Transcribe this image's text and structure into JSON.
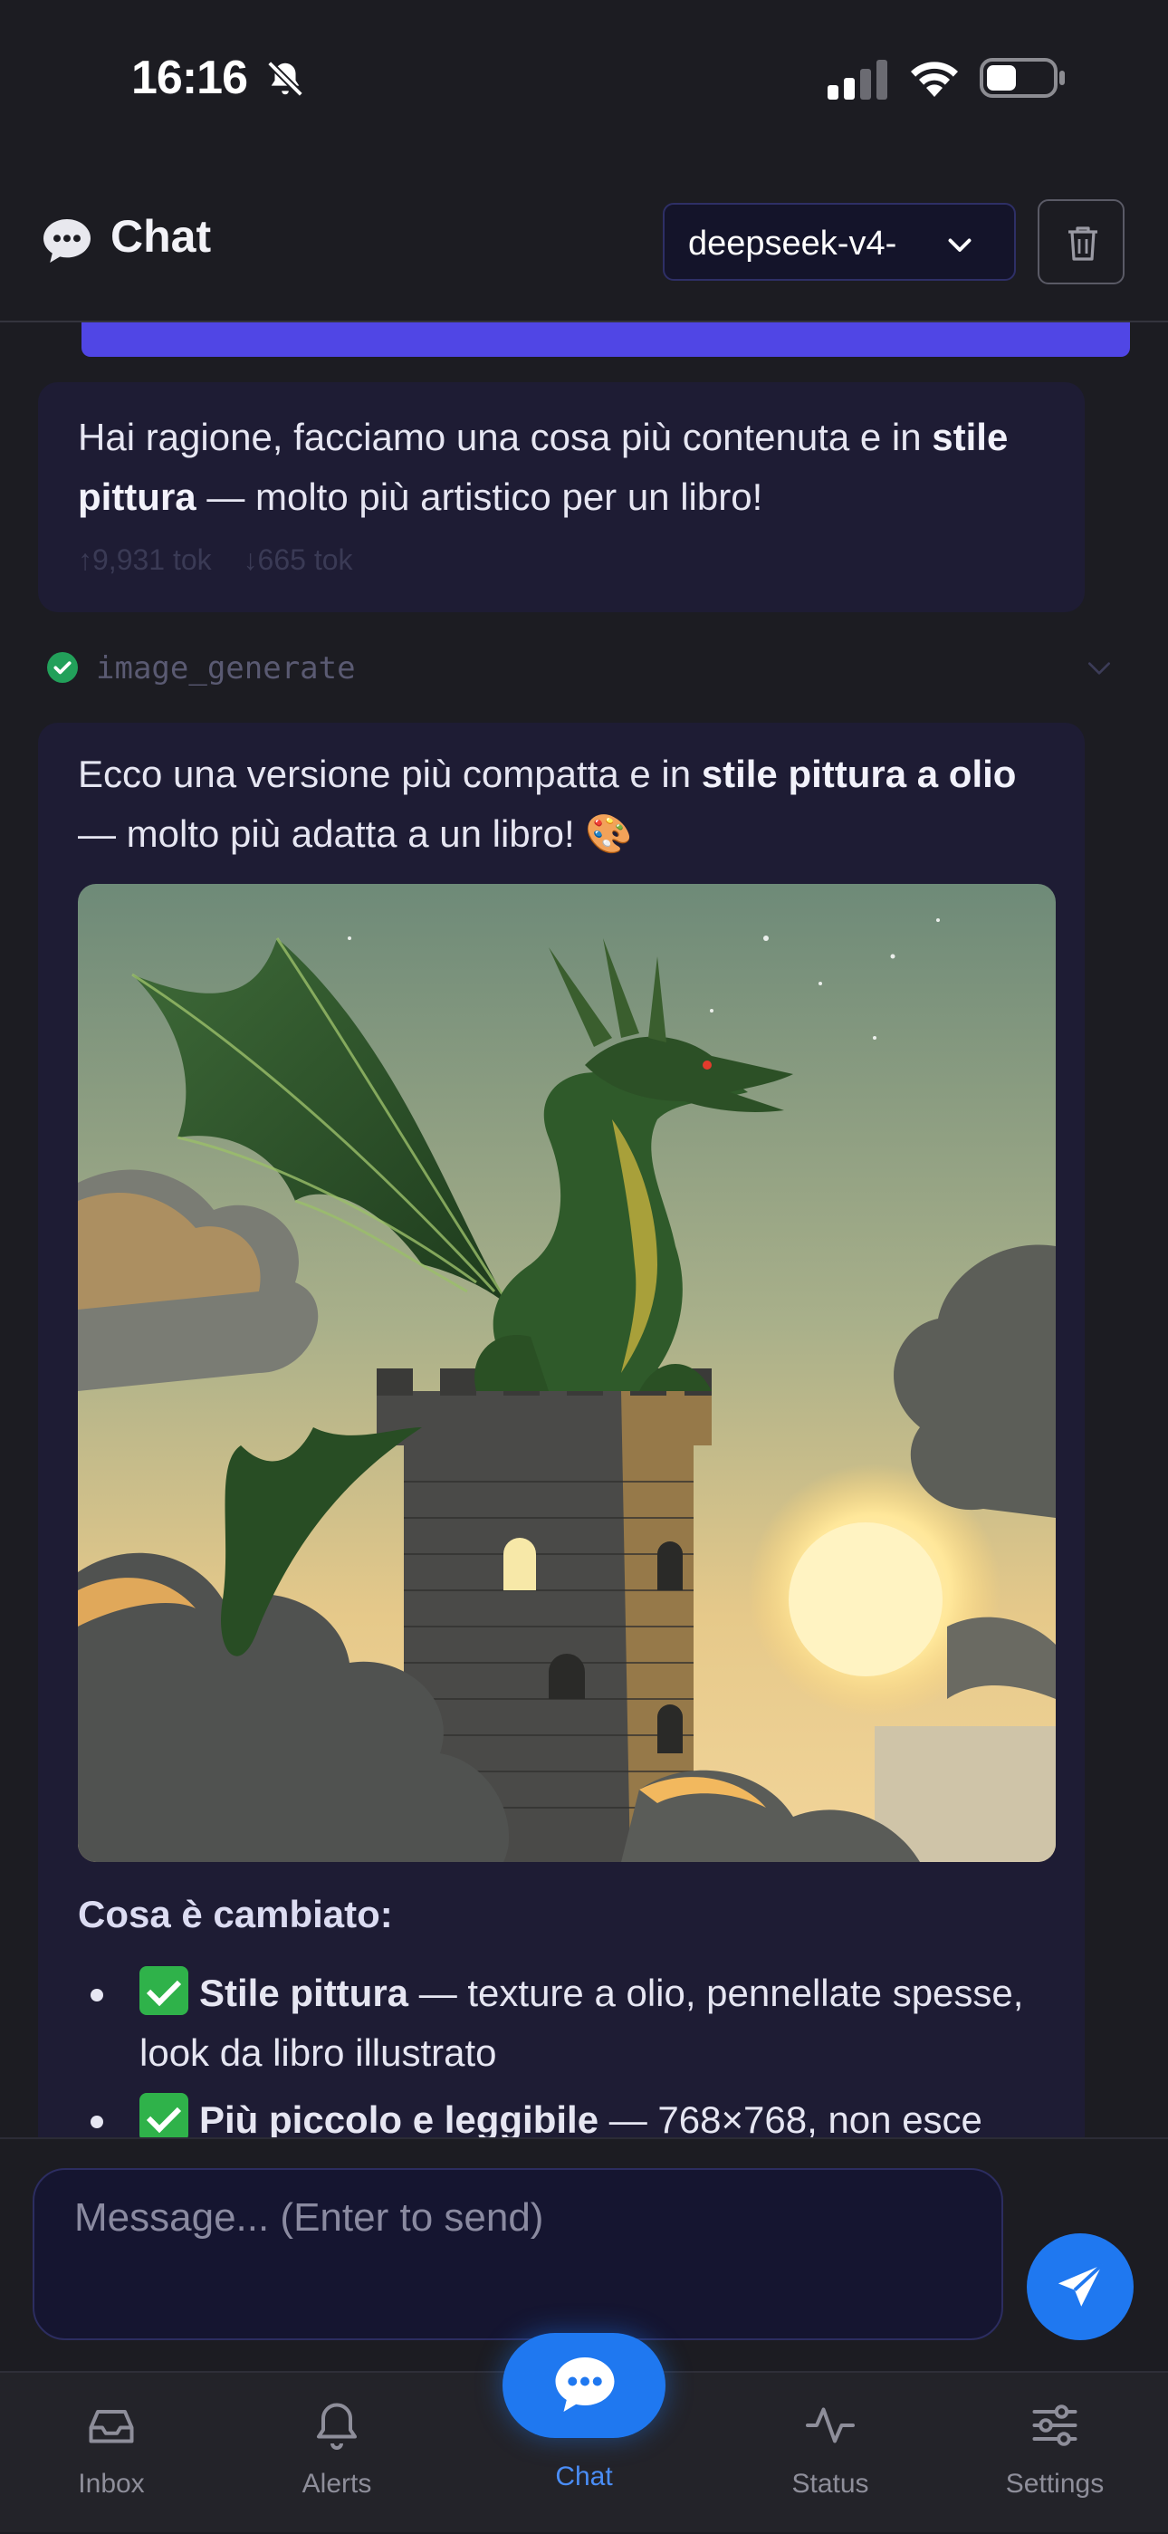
{
  "status_bar": {
    "time": "16:16",
    "icons": [
      "bell-off-icon",
      "signal-icon",
      "wifi-icon",
      "battery-icon"
    ]
  },
  "header": {
    "title": "Chat",
    "model_select": {
      "value": "deepseek-v4-"
    },
    "icons": [
      "chat-bubble-icon",
      "chevron-down-icon",
      "trash-icon"
    ]
  },
  "messages": {
    "assistant_1": {
      "text_before": "Hai ragione, facciamo una cosa più contenuta e in ",
      "bold": "stile pittura",
      "text_after": " — molto più artistico per un libro!",
      "tokens_in": "↑9,931 tok",
      "tokens_out": "↓665 tok"
    },
    "tool_call": {
      "name": "image_generate",
      "status": "success"
    },
    "assistant_2": {
      "text_1": "Ecco una versione più compatta e in ",
      "bold_1": "stile pittura a olio",
      "text_2": " — molto più adatta a un libro! 🎨",
      "image_subject": "green dragon perched on a stone tower among clouds at sunset",
      "section_heading": "Cosa è cambiato:",
      "bullets": [
        {
          "bold": "Stile pittura",
          "text": " — texture a olio, pennellate spesse, look da libro illustrato"
        },
        {
          "bold": "Più piccolo e leggibile",
          "text": " — 768×768, non esce"
        }
      ]
    }
  },
  "input": {
    "placeholder": "Message... (Enter to send)",
    "value": ""
  },
  "tabbar": {
    "inbox": "Inbox",
    "alerts": "Alerts",
    "chat": "Chat",
    "status": "Status",
    "settings": "Settings",
    "active": "chat"
  },
  "colors": {
    "background": "#1c1c22",
    "bubble": "#1e1c34",
    "user_bubble": "#5046e5",
    "accent": "#1f78f0",
    "success": "#22a05a"
  }
}
